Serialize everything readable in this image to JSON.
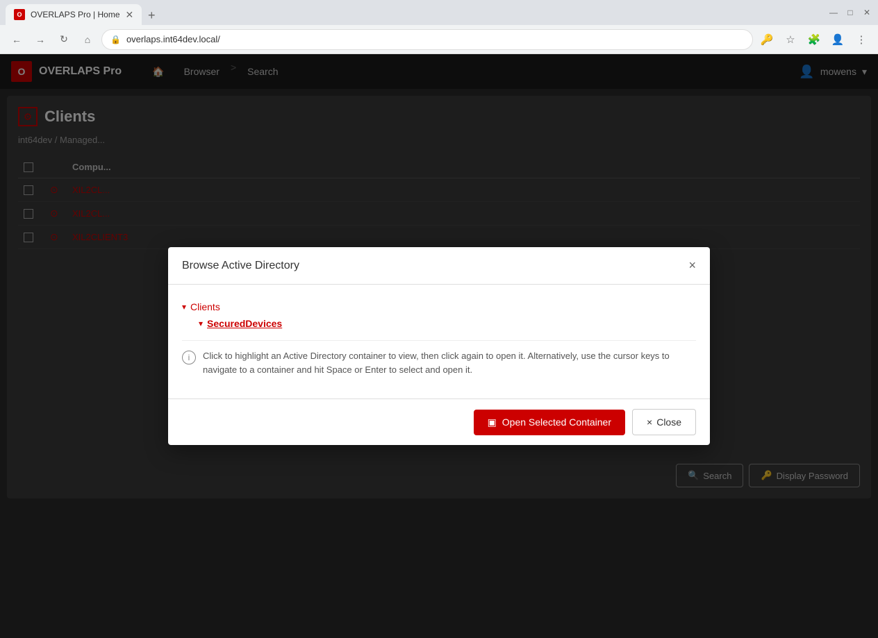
{
  "browser": {
    "tab_title": "OVERLAPS Pro | Home",
    "tab_favicon": "O",
    "new_tab_icon": "+",
    "address": "overlaps.int64dev.local/",
    "nav_back": "←",
    "nav_forward": "→",
    "nav_reload": "↻",
    "nav_home": "⌂",
    "win_minimize": "—",
    "win_maximize": "□",
    "win_close": "✕",
    "toolbar_key": "🔑",
    "toolbar_star": "☆",
    "toolbar_puzzle": "🧩",
    "toolbar_profile": "👤",
    "toolbar_menu": "⋮"
  },
  "app": {
    "logo_text": "O",
    "name": "OVERLAPS Pro",
    "nav": [
      {
        "label": "🏠",
        "id": "home"
      },
      {
        "label": "Browser",
        "id": "browser"
      },
      {
        "label": ">",
        "id": "sep"
      },
      {
        "label": "Search",
        "id": "search"
      }
    ],
    "user": "mowens",
    "user_caret": "▾"
  },
  "page": {
    "title": "Clients",
    "breadcrumb": "int64dev / Managed...",
    "table_cols": [
      "",
      "",
      "Compu..."
    ],
    "rows": [
      {
        "name": "XIL2CL...",
        "status": "⊙",
        "end_icon": "⧖"
      },
      {
        "name": "XIL2CL...",
        "status": "⊙",
        "end_icon": "⧖"
      },
      {
        "name": "XIL2CLIENT3",
        "status": "⊙",
        "end_icon": "⚠"
      }
    ],
    "btn_search": "Search",
    "btn_display_password": "Display Password"
  },
  "modal": {
    "title": "Browse Active Directory",
    "close_icon": "×",
    "tree": {
      "root_label": "Clients",
      "root_arrow": "▾",
      "child_label": "SecuredDevices",
      "child_arrow": "▾"
    },
    "info_text": "Click to highlight an Active Directory container to view, then click again to open it. Alternatively, use the cursor keys to navigate to a container and hit Space or Enter to select and open it.",
    "btn_open_label": "Open Selected Container",
    "btn_open_icon": "▣",
    "btn_close_label": "Close",
    "btn_close_icon": "×"
  }
}
